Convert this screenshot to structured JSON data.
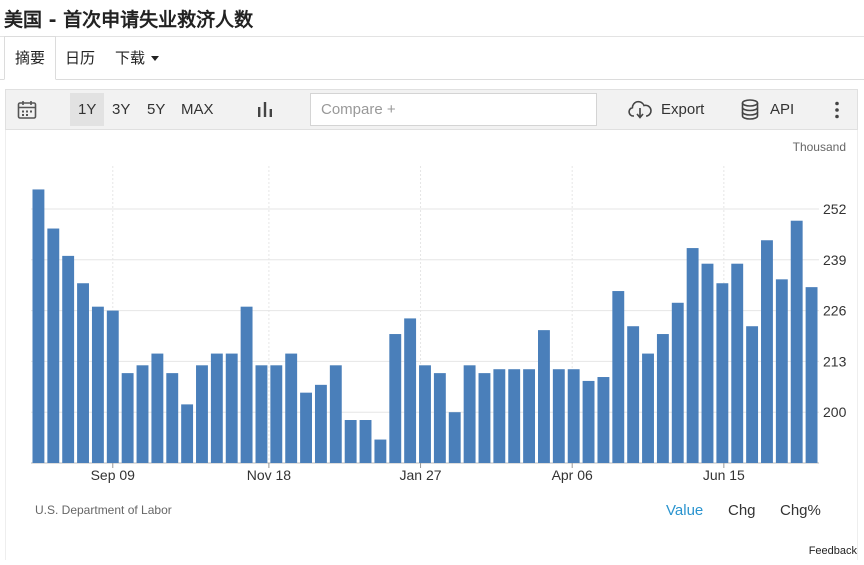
{
  "page": {
    "title": "美国 - 首次申请失业救济人数"
  },
  "tabs": [
    {
      "label": "摘要",
      "active": true
    },
    {
      "label": "日历"
    },
    {
      "label": "下载"
    }
  ],
  "toolbar": {
    "ranges": [
      "1Y",
      "3Y",
      "5Y",
      "MAX"
    ],
    "active_range": "1Y",
    "compare_placeholder": "Compare +",
    "export_label": "Export",
    "api_label": "API",
    "icons": [
      "calendar-icon",
      "bar-chart-icon",
      "cloud-download-icon",
      "database-icon",
      "more-vertical-icon"
    ]
  },
  "chart_data": {
    "type": "bar",
    "unit": "Thousand",
    "color": "#4a7fba",
    "x_ticks": [
      "Sep 09",
      "Nov 18",
      "Jan 27",
      "Apr 06",
      "Jun 15"
    ],
    "y_ticks": [
      200,
      213,
      226,
      239,
      252
    ],
    "ylim": [
      187,
      263
    ],
    "grid": true,
    "values": [
      257,
      247,
      240,
      233,
      227,
      226,
      210,
      212,
      215,
      210,
      202,
      212,
      215,
      215,
      227,
      212,
      212,
      215,
      205,
      207,
      212,
      198,
      198,
      193,
      220,
      224,
      212,
      210,
      200,
      212,
      210,
      211,
      211,
      211,
      221,
      211,
      211,
      208,
      209,
      231,
      222,
      215,
      220,
      228,
      242,
      238,
      233,
      238,
      222,
      244,
      234,
      249,
      232
    ]
  },
  "footer": {
    "source": "U.S. Department of Labor",
    "value_label": "Value",
    "chg_label": "Chg",
    "chgpct_label": "Chg%",
    "feedback": "Feedback"
  }
}
